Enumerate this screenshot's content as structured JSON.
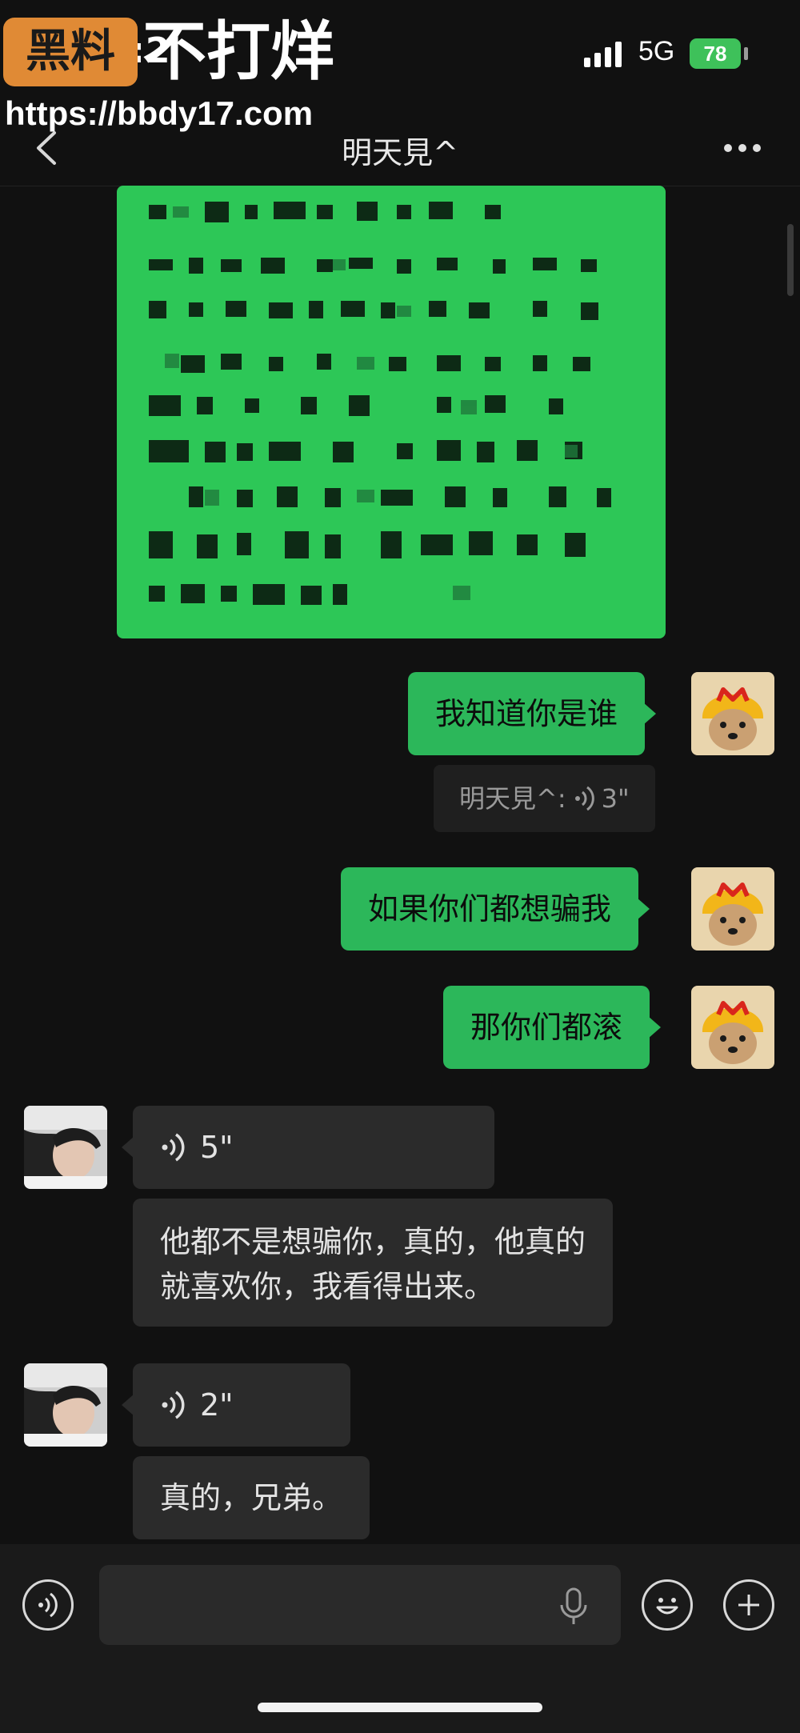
{
  "status_bar": {
    "time": "15:2",
    "network": "5G",
    "battery": "78"
  },
  "watermark": {
    "badge": "黑料",
    "text": "不打烊",
    "url": "https://bbdy17.com"
  },
  "header": {
    "title": "明天見^"
  },
  "messages": {
    "m1_text": "我知道你是谁",
    "quote_sender": "明天見^:",
    "quote_duration": "3\"",
    "m2_text": "如果你们都想骗我",
    "m3_text": "那你们都滚",
    "m4_voice": "5\"",
    "m5_line1": "他都不是想骗你，真的，他真的",
    "m5_line2": "就喜欢你，我看得出来。",
    "m6_voice": "2\"",
    "m7_text": "真的，兄弟。"
  },
  "colors": {
    "background": "#111111",
    "outgoing_bubble": "#2cb75a",
    "incoming_bubble": "#2b2b2b",
    "battery": "#3ec15a",
    "watermark_badge": "#e08a35"
  },
  "icons": {
    "back": "chevron-left-icon",
    "more": "more-dots-icon",
    "voice_input": "voice-icon",
    "mic": "mic-icon",
    "emoji": "emoji-icon",
    "plus": "plus-icon"
  }
}
